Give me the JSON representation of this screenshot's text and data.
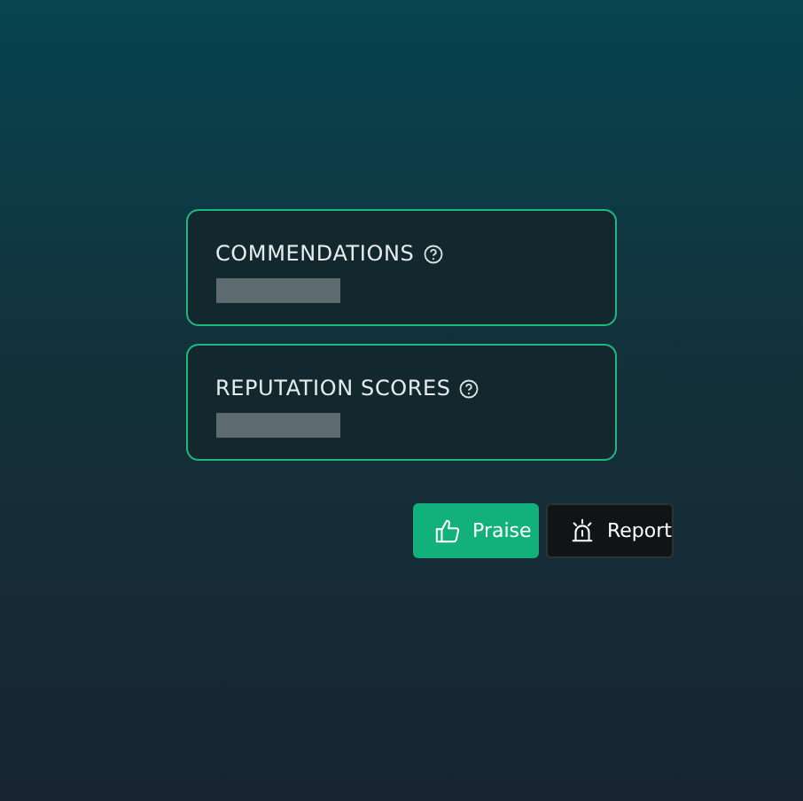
{
  "cards": [
    {
      "title": "COMMENDATIONS"
    },
    {
      "title": "REPUTATION SCORES"
    }
  ],
  "buttons": [
    {
      "label": "Praise",
      "kind": "praise"
    },
    {
      "label": "Report",
      "kind": "report"
    }
  ]
}
